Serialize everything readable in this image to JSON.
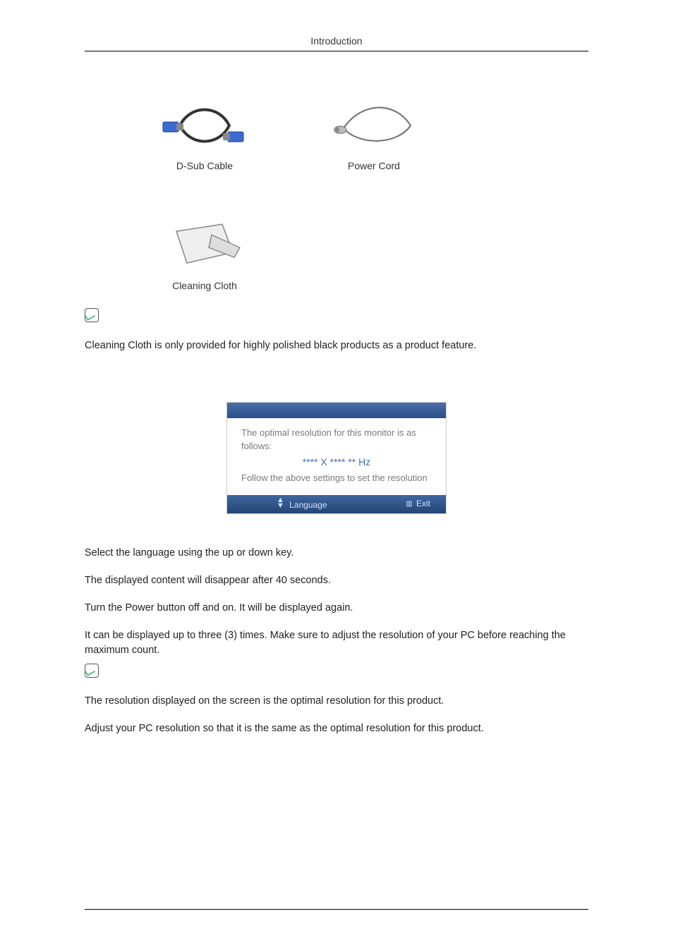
{
  "header": {
    "title": "Introduction"
  },
  "items": [
    {
      "caption": "D-Sub Cable"
    },
    {
      "caption": "Power Cord"
    },
    {
      "caption": "Cleaning Cloth"
    }
  ],
  "note1": "Cleaning Cloth is only provided for highly polished black products as a product feature.",
  "osd": {
    "line1": "The optimal resolution for this monitor is as follows:",
    "res": "**** X **** ** Hz",
    "line2": "Follow the above settings to set the resolution",
    "lang_label": "Language",
    "exit_label": "Exit"
  },
  "paras": [
    "Select the language using the up or down key.",
    "The displayed content will disappear after 40 seconds.",
    "Turn the Power button off and on. It will be displayed again.",
    "It can be displayed up to three (3) times. Make sure to adjust the resolution of your PC before reaching the maximum count."
  ],
  "note2a": "The resolution displayed on the screen is the optimal resolution for this product.",
  "note2b": "Adjust your PC resolution so that it is the same as the optimal resolution for this product."
}
